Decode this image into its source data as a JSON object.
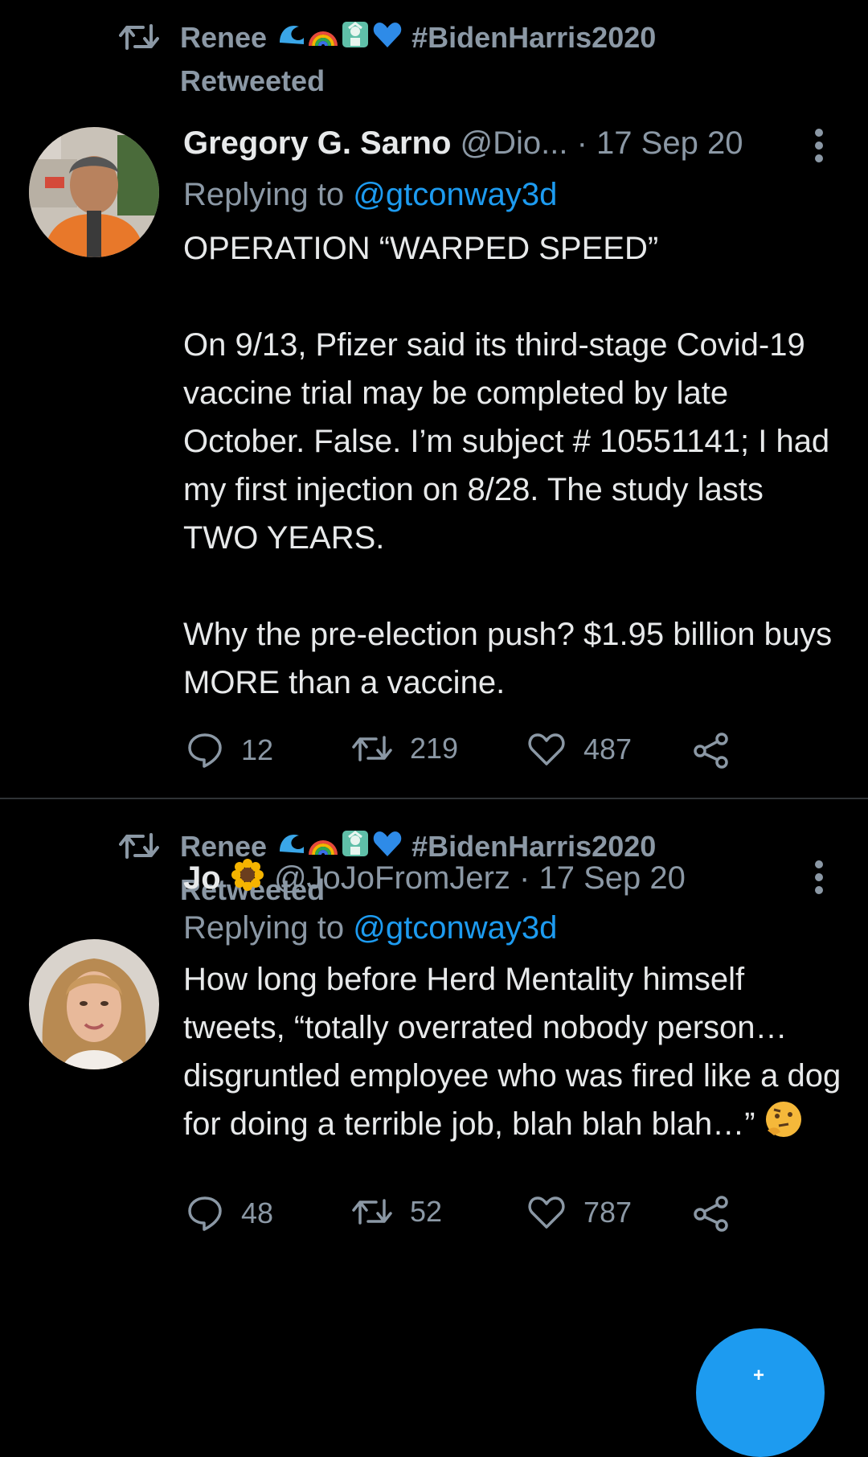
{
  "tweets": [
    {
      "retweeter": "Renee",
      "retweeter_hashtag": "#BidenHarris2020",
      "retweeted_label": "Retweeted",
      "author_name": "Gregory G. Sarno",
      "author_handle": "@Dio... · 17 Sep 20",
      "replying_label": "Replying to",
      "replying_to": "@gtconway3d",
      "text": "OPERATION “WARPED SPEED”\n\nOn 9/13, Pfizer said its third-stage Covid-19 vaccine trial may be completed by late October. False. I’m subject # 10551141; I had my first injection on 8/28. The study lasts TWO YEARS.\n\nWhy the pre-election push? $1.95 billion buys MORE than a vaccine.",
      "replies": "12",
      "retweets": "219",
      "likes": "487"
    },
    {
      "retweeter": "Renee",
      "retweeter_hashtag": "#BidenHarris2020",
      "retweeted_label": "Retweeted",
      "author_name": "Jo",
      "author_handle": "@JoJoFromJerz · 17 Sep 20",
      "replying_label": "Replying to",
      "replying_to": "@gtconway3d",
      "text": "How long before Herd Mentality himself tweets, “totally overrated nobody person… disgruntled employee who was fired like a dog for doing a terrible job, blah blah blah…”",
      "replies": "48",
      "retweets": "52",
      "likes": "787"
    }
  ],
  "colors": {
    "background": "#000000",
    "text_primary": "#e7e9ea",
    "text_secondary": "#8b98a5",
    "accent": "#1d9bf0",
    "divider": "#2f3336"
  },
  "icons": [
    "retweet-icon",
    "reply-icon",
    "like-icon",
    "share-icon",
    "more-icon",
    "compose-icon"
  ]
}
